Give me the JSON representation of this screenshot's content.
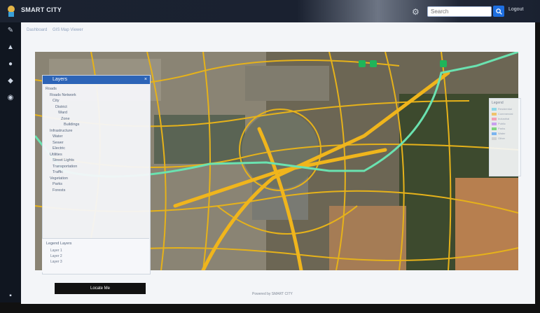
{
  "app": {
    "title": "SMART CITY",
    "logout_label": "Logout"
  },
  "search": {
    "placeholder": "Search"
  },
  "breadcrumb": [
    "Dashboard",
    "GIS Map Viewer"
  ],
  "layers_panel": {
    "title": "Layers",
    "items": [
      "Roads",
      "Roads Network",
      "City",
      "District",
      "Ward",
      "Zone",
      "Buildings",
      "Infrastructure",
      "Water",
      "Sewer",
      "Electric",
      "Utilities",
      "Street Lights",
      "Transportation",
      "Traffic",
      "Vegetation",
      "Parks",
      "Forests"
    ]
  },
  "bottom_panel": {
    "title": "Legend Layers",
    "items": [
      "Layer 1",
      "Layer 2",
      "Layer 3"
    ]
  },
  "legend": {
    "title": "Legend",
    "items": [
      {
        "label": "Residential",
        "color": "#8fd7e6"
      },
      {
        "label": "Commercial",
        "color": "#f0c36a"
      },
      {
        "label": "Industrial",
        "color": "#f1a0b8"
      },
      {
        "label": "Public",
        "color": "#c9a0ef"
      },
      {
        "label": "Parks",
        "color": "#7fd57f"
      },
      {
        "label": "Water",
        "color": "#7ab4f0"
      },
      {
        "label": "Other",
        "color": "#d0d0d0"
      }
    ]
  },
  "zoom_button_label": "Locate Me",
  "footer": "Powered by SMART CITY",
  "colors": {
    "topbar": "#1a2130",
    "accent": "#1e6fe0",
    "road": "#e6b21a",
    "metro": "#6ae2b0"
  }
}
